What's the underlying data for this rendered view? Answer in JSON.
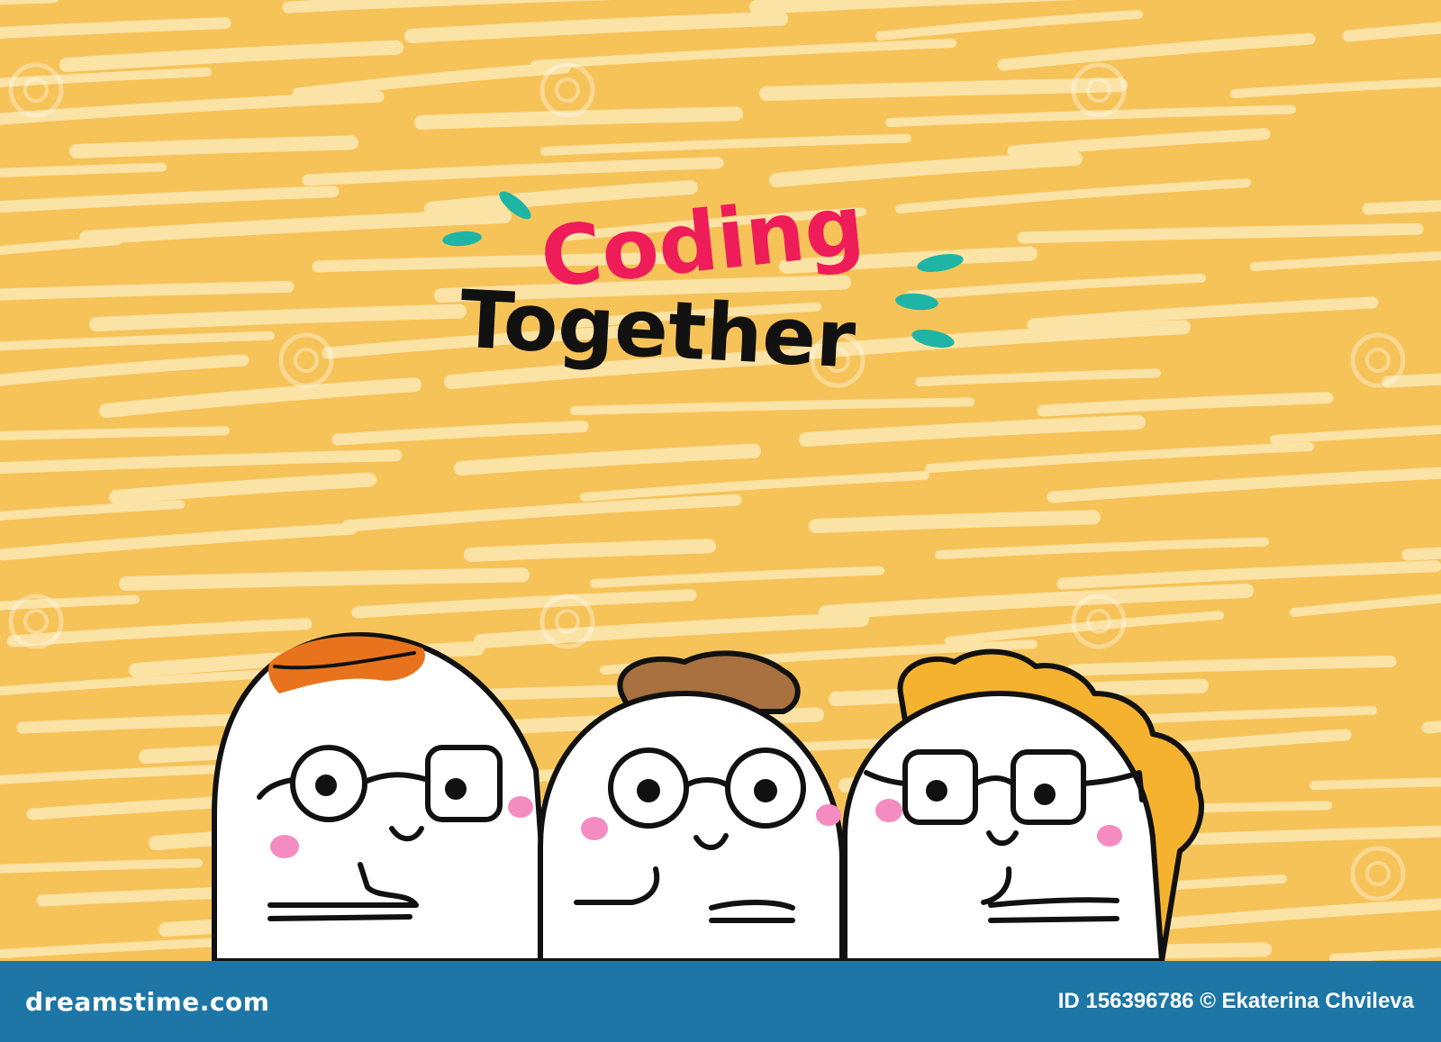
{
  "illustration": {
    "headline_line1": "Coding",
    "headline_line2": "Together",
    "background_color": "#f6c359",
    "stripe_color": "#fbe3a6",
    "headline_line1_color": "#ee1c59",
    "headline_line2_color": "#111111",
    "sparkle_color": "#1fb5a5",
    "blush_color": "#f48cc1",
    "hair_colors": [
      "#e8731c",
      "#a8713f",
      "#f5b22f"
    ],
    "watermark_text": "dreamstime"
  },
  "footer": {
    "logo_text": "dreamstime.com",
    "credit_text": "ID 156396786 © Ekaterina Chvileva",
    "background_color": "#1d76a6"
  }
}
